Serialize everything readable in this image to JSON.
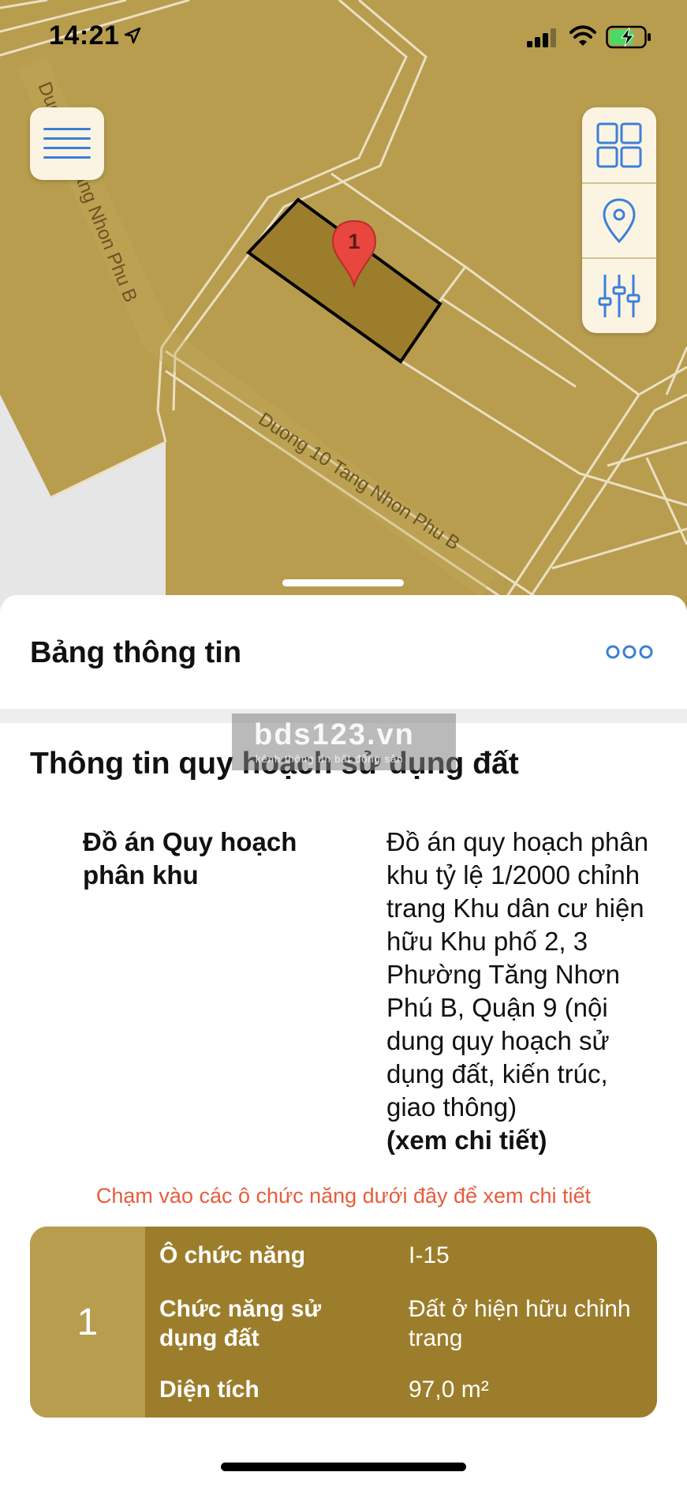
{
  "status_bar": {
    "time": "14:21",
    "icons": [
      "location-arrow-icon",
      "signal-icon",
      "wifi-icon",
      "battery-charging-icon"
    ]
  },
  "map": {
    "road_labels": [
      "Duong 10 Tang Nhon Phu B",
      "Duong 10 Tang Nhon Phu B"
    ],
    "marker_label": "1",
    "colors": {
      "land": "#b89d4f",
      "selected_parcel": "#9c7d2b",
      "road_line": "#e8dcc0",
      "marker": "#e8463e",
      "accent": "#3b7fd9"
    }
  },
  "map_controls": {
    "menu_icon": "hamburger-menu-icon",
    "tools": [
      "grid-layers-icon",
      "location-pin-icon",
      "sliders-icon"
    ]
  },
  "sheet": {
    "title": "Bảng thông tin",
    "more_icon": "more-dots-icon",
    "section_title": "Thông tin quy hoạch sử dụng đất",
    "watermark": {
      "main": "bds123.vn",
      "sub": "kênh thông tin bất động sản"
    },
    "plan": {
      "label": "Đồ án Quy hoạch phân khu",
      "value": "Đồ án quy hoạch phân khu tỷ lệ 1/2000 chỉnh trang Khu dân cư hiện hữu Khu phố 2, 3 Phường Tăng Nhơn Phú B, Quận 9 (nội dung quy hoạch sử dụng đất, kiến trúc, giao thông)",
      "link": "(xem chi tiết)"
    },
    "hint": "Chạm vào các ô chức năng dưới đây để xem chi tiết",
    "cell": {
      "index": "1",
      "rows": [
        {
          "key": "Ô chức năng",
          "value": "I-15"
        },
        {
          "key": "Chức năng sử dụng đất",
          "value": "Đất ở hiện hữu chỉnh trang"
        },
        {
          "key": "Diện tích",
          "value": "97,0 m²"
        }
      ]
    }
  }
}
